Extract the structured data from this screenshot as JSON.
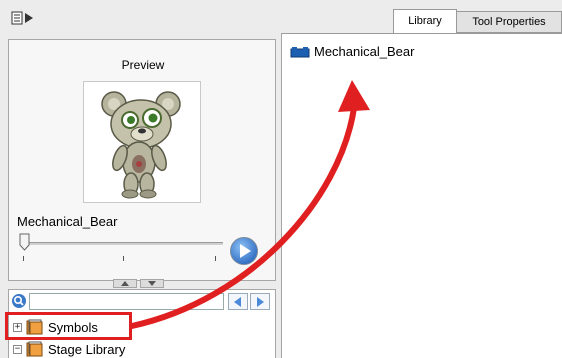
{
  "toolbar": {
    "menu_icon": "panel-menu-icon"
  },
  "tabs": [
    {
      "label": "Library",
      "active": true
    },
    {
      "label": "Tool Properties",
      "active": false
    }
  ],
  "preview": {
    "label": "Preview",
    "item_name": "Mechanical_Bear",
    "image_icon": "bear-character-image"
  },
  "playback": {
    "play_icon": "play-icon"
  },
  "search": {
    "value": "",
    "placeholder": "",
    "icon": "search-icon",
    "prev_icon": "prev-arrow-icon",
    "next_icon": "next-arrow-icon"
  },
  "tree": [
    {
      "label": "Symbols",
      "expanded": false,
      "highlighted": true
    },
    {
      "label": "Stage Library",
      "expanded": true,
      "highlighted": false
    }
  ],
  "library": {
    "items": [
      {
        "label": "Mechanical_Bear",
        "icon": "library-folder-icon"
      }
    ]
  },
  "colors": {
    "highlight": "#e02020",
    "accent": "#1d5fb0",
    "play_button": "#3a7bd5"
  }
}
